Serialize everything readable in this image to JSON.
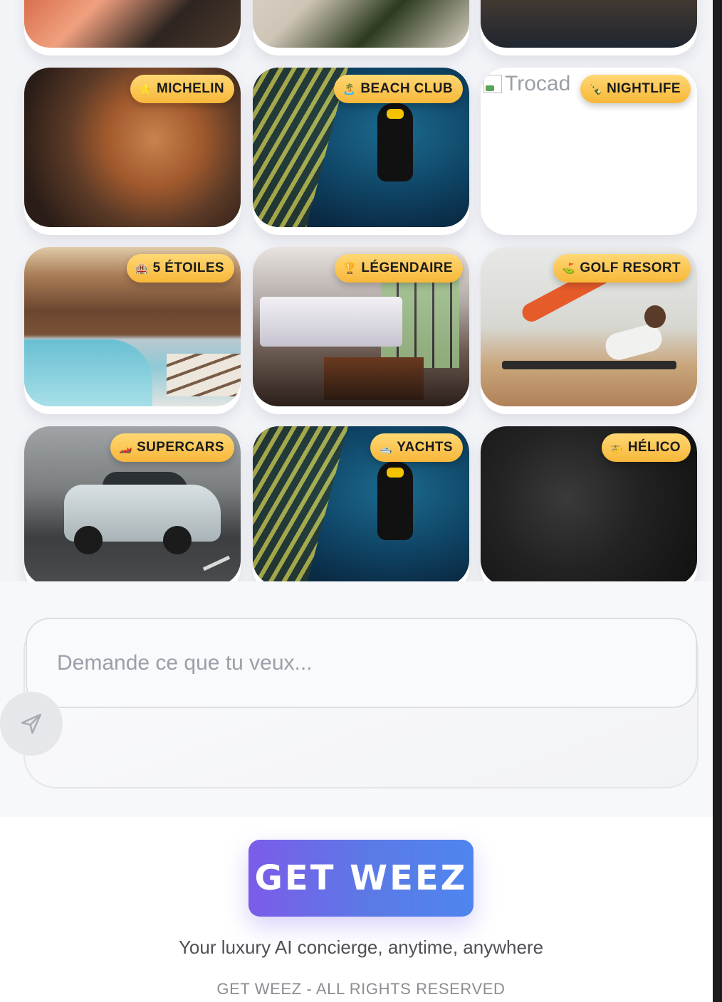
{
  "grid": {
    "top_row": [
      {
        "photo": "sushi-platter-photo"
      },
      {
        "photo": "kitchen-chopping-photo"
      },
      {
        "photo": "restaurant-interior-photo"
      }
    ],
    "cards": [
      {
        "badge": "MICHELIN",
        "icon": "⭐",
        "photo": "grilled-meat-platter-photo"
      },
      {
        "badge": "BEACH CLUB",
        "icon": "🏝️",
        "photo": "scuba-diver-photo"
      },
      {
        "badge": "NIGHTLIFE",
        "icon": "🍾",
        "photo": "broken-image",
        "broken_alt": "Trocad"
      },
      {
        "badge": "5 ÉTOILES",
        "icon": "🏨",
        "photo": "resort-pool-photo"
      },
      {
        "badge": "LÉGENDAIRE",
        "icon": "🏆",
        "photo": "luxury-bedroom-photo"
      },
      {
        "badge": "GOLF RESORT",
        "icon": "⛳",
        "photo": "fitness-woman-photo"
      },
      {
        "badge": "SUPERCARS",
        "icon": "🏎️",
        "photo": "white-bmw-photo"
      },
      {
        "badge": "YACHTS",
        "icon": "🛥️",
        "photo": "scuba-diver-photo"
      },
      {
        "badge": "HÉLICO",
        "icon": "🚁",
        "photo": "dark-texture-photo"
      }
    ]
  },
  "composer": {
    "placeholder": "Demande ce que tu veux...",
    "send_icon": "send-icon"
  },
  "footer": {
    "brand_button": "GET WEEZ",
    "tagline": "Your luxury AI concierge, anytime, anywhere",
    "copyright": "GET WEEZ - ALL RIGHTS RESERVED"
  },
  "colors": {
    "badge_gradient": [
      "#ffd873",
      "#f7b73a"
    ],
    "brand_gradient": [
      "#7b5ce8",
      "#4f85ee"
    ]
  }
}
